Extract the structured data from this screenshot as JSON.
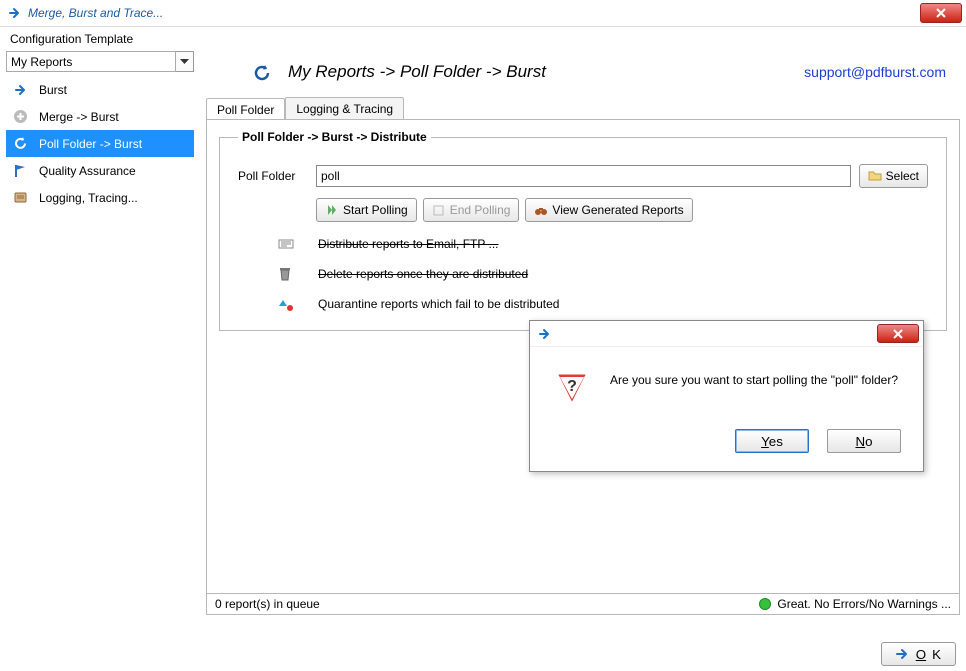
{
  "window": {
    "title": "Merge, Burst and Trace..."
  },
  "config": {
    "label": "Configuration Template",
    "selected": "My Reports"
  },
  "sidebar": {
    "items": [
      {
        "label": "Burst"
      },
      {
        "label": "Merge -> Burst"
      },
      {
        "label": "Poll Folder -> Burst"
      },
      {
        "label": "Quality Assurance"
      },
      {
        "label": "Logging, Tracing..."
      }
    ]
  },
  "header": {
    "breadcrumb": "My Reports -> Poll Folder -> Burst",
    "support_link": "support@pdfburst.com"
  },
  "tabs": [
    {
      "label": "Poll Folder"
    },
    {
      "label": "Logging & Tracing"
    }
  ],
  "panel": {
    "legend": "Poll Folder -> Burst -> Distribute",
    "poll_folder_label": "Poll Folder",
    "poll_folder_value": "poll",
    "select_label": "Select",
    "start_polling_label": "Start Polling",
    "end_polling_label": "End Polling",
    "view_reports_label": "View Generated Reports",
    "distribute_label": "Distribute reports to Email, FTP ...",
    "delete_label": "Delete reports once they are distributed",
    "quarantine_label": "Quarantine reports which fail to be distributed"
  },
  "dialog": {
    "message": "Are you sure you want to start polling the \"poll\" folder?",
    "yes": "Yes",
    "no": "No"
  },
  "status": {
    "queue": "0 report(s) in queue",
    "ok_msg": "Great. No Errors/No Warnings ..."
  },
  "footer": {
    "ok": "OK"
  }
}
